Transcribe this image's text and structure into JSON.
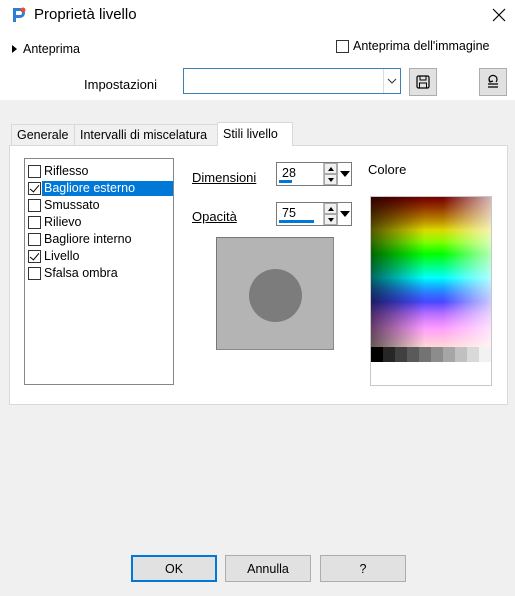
{
  "window": {
    "title": "Proprietà livello",
    "app_icon": "paintshop-icon",
    "close_icon": "close-icon"
  },
  "top": {
    "preview_toggle_label": "Anteprima",
    "image_preview_label": "Anteprima dell'immagine",
    "image_preview_checked": false,
    "settings_label": "Impostazioni",
    "settings_value": "",
    "save_icon": "save-icon",
    "reset_icon": "reset-icon"
  },
  "tabs": [
    {
      "label": "Generale",
      "active": false
    },
    {
      "label": "Intervalli di miscelatura",
      "active": false
    },
    {
      "label": "Stili livello",
      "active": true
    }
  ],
  "styles": {
    "items": [
      {
        "label": "Riflesso",
        "checked": false,
        "selected": false
      },
      {
        "label": "Bagliore esterno",
        "checked": true,
        "selected": true
      },
      {
        "label": "Smussato",
        "checked": false,
        "selected": false
      },
      {
        "label": "Rilievo",
        "checked": false,
        "selected": false
      },
      {
        "label": "Bagliore interno",
        "checked": false,
        "selected": false
      },
      {
        "label": "Livello",
        "checked": true,
        "selected": false
      },
      {
        "label": "Sfalsa ombra",
        "checked": false,
        "selected": false
      }
    ],
    "dimensioni_label": "Dimensioni",
    "dimensioni_value": "28",
    "dimensioni_level": 0.28,
    "opacita_label": "Opacità",
    "opacita_value": "75",
    "opacita_level": 0.75,
    "colore_label": "Colore"
  },
  "buttons": {
    "ok": "OK",
    "cancel": "Annulla",
    "help": "?"
  },
  "colors": {
    "accent": "#0078d7",
    "preview_bg": "#b4b4b4",
    "preview_circle": "#7c7c7c"
  }
}
